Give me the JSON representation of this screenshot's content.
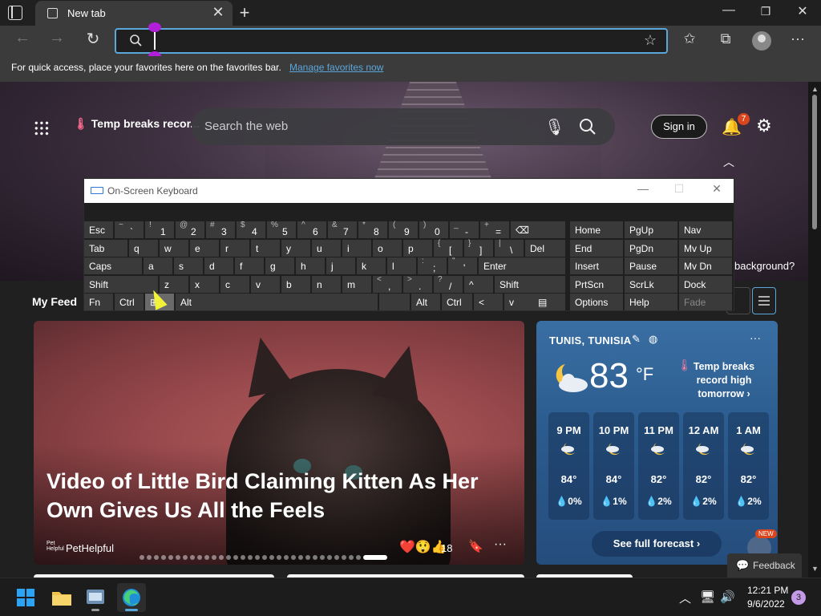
{
  "browser": {
    "tab_title": "New tab",
    "address_value": "",
    "favorites_hint": "For quick access, place your favorites here on the favorites bar.",
    "manage_favorites": "Manage favorites now"
  },
  "newtab": {
    "trending": "Temp breaks recor...",
    "search_placeholder": "Search the web",
    "sign_in": "Sign in",
    "notification_count": "7",
    "background_question": "background?",
    "my_feed": "My Feed"
  },
  "main_card": {
    "title": "Video of Little Bird Claiming Kitten As Her Own Gives Us All the Feels",
    "source": "PetHelpful",
    "source_logo": "Pet Helpful",
    "reaction_count": "18",
    "carousel_total": 32,
    "carousel_active": 32
  },
  "weather": {
    "location": "TUNIS, TUNISIA",
    "temperature": "83",
    "unit": "°F",
    "alert": "Temp breaks record high tomorrow",
    "hours": [
      {
        "time": "9 PM",
        "temp": "84°",
        "rain": "0%"
      },
      {
        "time": "10 PM",
        "temp": "84°",
        "rain": "1%"
      },
      {
        "time": "11 PM",
        "temp": "82°",
        "rain": "2%"
      },
      {
        "time": "12 AM",
        "temp": "82°",
        "rain": "2%"
      },
      {
        "time": "1 AM",
        "temp": "82°",
        "rain": "2%"
      }
    ],
    "forecast_button": "See full forecast",
    "new_badge": "NEW"
  },
  "feedback": "Feedback",
  "osk": {
    "title": "On-Screen Keyboard",
    "keys": [
      {
        "label": "Esc",
        "top": "",
        "bottom": ""
      },
      {
        "label": "",
        "top": "~",
        "bottom": "`"
      },
      {
        "label": "",
        "top": "!",
        "bottom": "1"
      },
      {
        "label": "",
        "top": "@",
        "bottom": "2"
      },
      {
        "label": "",
        "top": "#",
        "bottom": "3"
      },
      {
        "label": "",
        "top": "$",
        "bottom": "4"
      },
      {
        "label": "",
        "top": "%",
        "bottom": "5"
      },
      {
        "label": "",
        "top": "^",
        "bottom": "6"
      },
      {
        "label": "",
        "top": "&",
        "bottom": "7"
      },
      {
        "label": "",
        "top": "*",
        "bottom": "8"
      },
      {
        "label": "",
        "top": "(",
        "bottom": "9"
      },
      {
        "label": "",
        "top": ")",
        "bottom": "0"
      },
      {
        "label": "",
        "top": "_",
        "bottom": "-"
      },
      {
        "label": "",
        "top": "+",
        "bottom": "="
      },
      {
        "label": "⌫",
        "top": "",
        "bottom": ""
      },
      {
        "label": "Home",
        "top": "",
        "bottom": ""
      },
      {
        "label": "PgUp",
        "top": "",
        "bottom": ""
      },
      {
        "label": "Nav",
        "top": "",
        "bottom": ""
      },
      {
        "label": "Tab",
        "top": "",
        "bottom": ""
      },
      {
        "label": "q"
      },
      {
        "label": "w"
      },
      {
        "label": "e"
      },
      {
        "label": "r"
      },
      {
        "label": "t"
      },
      {
        "label": "y"
      },
      {
        "label": "u"
      },
      {
        "label": "i"
      },
      {
        "label": "o"
      },
      {
        "label": "p"
      },
      {
        "label": "",
        "top": "{",
        "bottom": "["
      },
      {
        "label": "",
        "top": "}",
        "bottom": "]"
      },
      {
        "label": "",
        "top": "|",
        "bottom": "\\"
      },
      {
        "label": "Del"
      },
      {
        "label": "End"
      },
      {
        "label": "PgDn"
      },
      {
        "label": "Mv Up"
      },
      {
        "label": "Caps"
      },
      {
        "label": "a"
      },
      {
        "label": "s"
      },
      {
        "label": "d"
      },
      {
        "label": "f"
      },
      {
        "label": "g"
      },
      {
        "label": "h"
      },
      {
        "label": "j"
      },
      {
        "label": "k"
      },
      {
        "label": "l"
      },
      {
        "label": "",
        "top": ":",
        "bottom": ";"
      },
      {
        "label": "",
        "top": "\"",
        "bottom": "'"
      },
      {
        "label": "Enter"
      },
      {
        "label": "Insert"
      },
      {
        "label": "Pause"
      },
      {
        "label": "Mv Dn"
      },
      {
        "label": "Shift"
      },
      {
        "label": "z"
      },
      {
        "label": "x"
      },
      {
        "label": "c"
      },
      {
        "label": "v"
      },
      {
        "label": "b"
      },
      {
        "label": "n"
      },
      {
        "label": "m"
      },
      {
        "label": "",
        "top": "<",
        "bottom": ","
      },
      {
        "label": "",
        "top": ">",
        "bottom": "."
      },
      {
        "label": "",
        "top": "?",
        "bottom": "/"
      },
      {
        "label": "^"
      },
      {
        "label": "Shift"
      },
      {
        "label": "PrtScn"
      },
      {
        "label": "ScrLk"
      },
      {
        "label": "Dock"
      },
      {
        "label": "Fn"
      },
      {
        "label": "Ctrl"
      },
      {
        "label": "⊞"
      },
      {
        "label": "Alt"
      },
      {
        "label": ""
      },
      {
        "label": "Alt"
      },
      {
        "label": "Ctrl"
      },
      {
        "label": "<"
      },
      {
        "label": "v"
      },
      {
        "label": ">"
      },
      {
        "label": "▤"
      },
      {
        "label": "Options"
      },
      {
        "label": "Help"
      },
      {
        "label": "Fade"
      }
    ]
  },
  "taskbar": {
    "time": "12:21 PM",
    "date": "9/6/2022",
    "notifications": "3"
  },
  "colors": {
    "accent": "#5aa7dc",
    "selection_handle": "#b11fd8",
    "badge": "#d9461d"
  }
}
